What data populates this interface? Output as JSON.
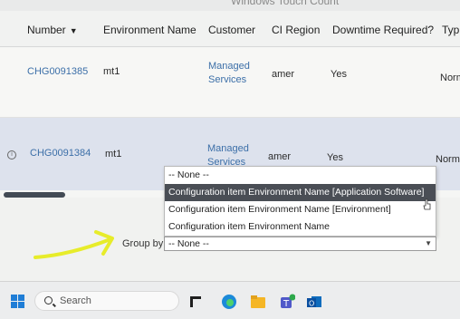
{
  "window": {
    "title": "Windows Touch Count"
  },
  "table": {
    "headers": {
      "number": "Number",
      "environment_name": "Environment Name",
      "customer": "Customer",
      "ci_region": "CI Region",
      "downtime_required": "Downtime Required?",
      "type": "Typ"
    },
    "rows": [
      {
        "number": "CHG0091385",
        "environment_name": "mt1",
        "customer_line1": "Managed",
        "customer_line2": "Services",
        "ci_region": "amer",
        "downtime_required": "Yes",
        "type": "Norm"
      },
      {
        "number": "CHG0091384",
        "environment_name": "mt1",
        "customer_line1": "Managed",
        "customer_line2": "Services",
        "ci_region": "amer",
        "downtime_required": "Yes",
        "type": "Norma"
      }
    ]
  },
  "group_by": {
    "label": "Group by",
    "selected_value": "-- None --",
    "options": [
      "-- None --",
      "Configuration item Environment Name [Application Software]",
      "Configuration item Environment Name [Environment]",
      "Configuration item Environment Name"
    ],
    "highlighted_option_index": 1
  },
  "taskbar": {
    "search_placeholder": "Search",
    "icons": [
      "windows-start-icon",
      "search-icon",
      "task-view-icon",
      "edge-browser-icon",
      "file-explorer-icon",
      "teams-icon",
      "outlook-icon"
    ]
  },
  "colors": {
    "link": "#3c6fa8",
    "selected_row": "#dde2ed",
    "highlighted_option": "#4a4e55",
    "annotation_arrow": "#e7ec2a"
  }
}
